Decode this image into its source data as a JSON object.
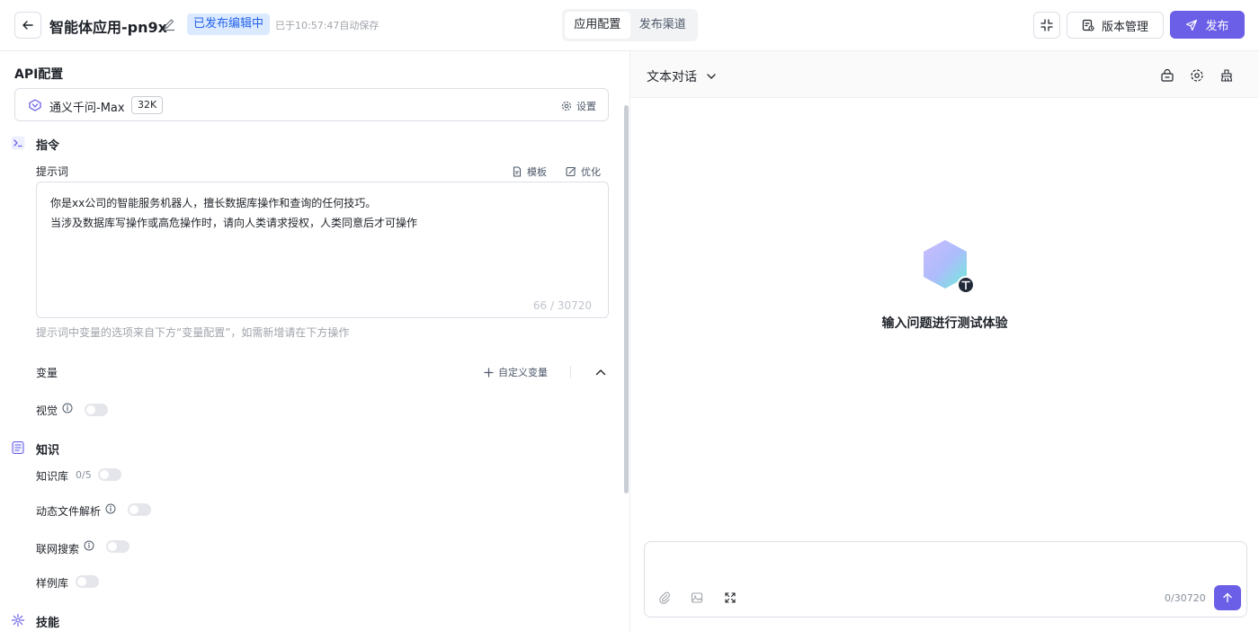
{
  "header": {
    "app_title": "智能体应用-pn9x",
    "status_badge": "已发布编辑中",
    "autosave_text": "已于10:57:47自动保存",
    "tabs": [
      {
        "label": "应用配置",
        "active": true
      },
      {
        "label": "发布渠道",
        "active": false
      }
    ],
    "version_label": "版本管理",
    "publish_label": "发布",
    "accent_color": "#6a5fe6"
  },
  "api_config": {
    "title": "API配置",
    "model_name": "通义千问-Max",
    "model_tag": "32K",
    "settings_label": "设置"
  },
  "instructions": {
    "title": "指令",
    "prompt_label": "提示词",
    "template_label": "模板",
    "optimize_label": "优化",
    "prompt_lines": [
      "你是xx公司的智能服务机器人，擅长数据库操作和查询的任何技巧。",
      "当涉及数据库写操作或高危操作时，请向人类请求授权，人类同意后才可操作"
    ],
    "prompt_counter": "66 / 30720",
    "hint": "提示词中变量的选项来自下方“变量配置”，如需新增请在下方操作",
    "variables_label": "变量",
    "custom_variable_label": "自定义变量",
    "vision_label": "视觉",
    "vision_enabled": false
  },
  "knowledge": {
    "title": "知识",
    "kb_label": "知识库",
    "kb_count": "0/5",
    "kb_enabled": false,
    "dynamic_file_label": "动态文件解析",
    "dynamic_file_enabled": false,
    "web_search_label": "联网搜索",
    "web_search_enabled": false,
    "sample_lib_label": "样例库",
    "sample_lib_enabled": false
  },
  "skills": {
    "title": "技能"
  },
  "preview": {
    "mode_label": "文本对话",
    "empty_text": "输入问题进行测试体验",
    "input_placeholder": "",
    "input_counter": "0/30720"
  }
}
